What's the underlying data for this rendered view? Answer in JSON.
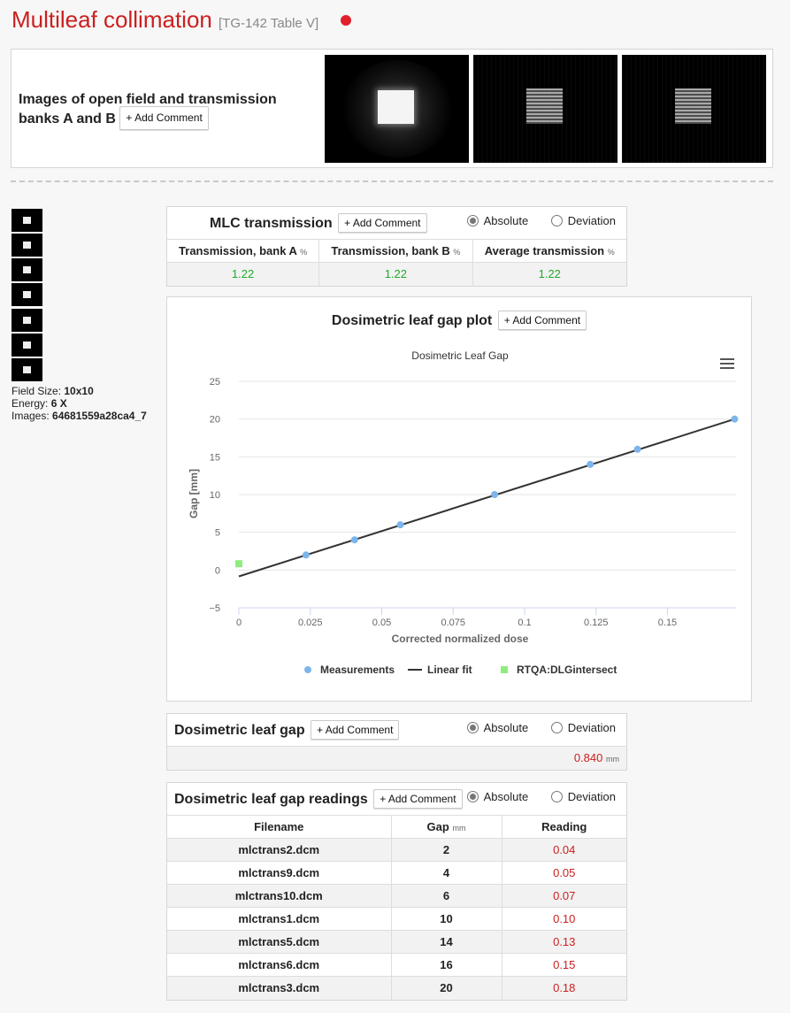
{
  "header": {
    "title": "Multileaf collimation",
    "reference": "[TG-142 Table V]",
    "status_color": "#e0202a"
  },
  "common": {
    "add_comment": "+ Add Comment",
    "absolute": "Absolute",
    "deviation": "Deviation"
  },
  "images_panel": {
    "title": "Images of open field and transmission banks A and B"
  },
  "field_info": {
    "field_size_label": "Field Size:",
    "field_size": "10x10",
    "energy_label": "Energy:",
    "energy": "6 X",
    "images_label": "Images:",
    "images": "64681559a28ca4_7"
  },
  "mlc_transmission": {
    "title": "MLC transmission",
    "mode": "Absolute",
    "columns": [
      {
        "label": "Transmission, bank A",
        "unit": "%"
      },
      {
        "label": "Transmission, bank B",
        "unit": "%"
      },
      {
        "label": "Average transmission",
        "unit": "%"
      }
    ],
    "values": [
      "1.22",
      "1.22",
      "1.22"
    ]
  },
  "chart_panel": {
    "title": "Dosimetric leaf gap plot"
  },
  "chart_data": {
    "type": "scatter",
    "title": "Dosimetric Leaf Gap",
    "xlabel": "Corrected normalized dose",
    "ylabel": "Gap [mm]",
    "xlim": [
      0,
      0.174
    ],
    "ylim": [
      -5,
      25
    ],
    "xticks": [
      "0",
      "0.025",
      "0.05",
      "0.075",
      "0.1",
      "0.125",
      "0.15"
    ],
    "yticks": [
      "25",
      "20",
      "15",
      "10",
      "5",
      "0",
      "−5"
    ],
    "grid": true,
    "legend_position": "bottom",
    "series": [
      {
        "name": "Measurements",
        "type": "scatter",
        "color": "#7cb5ec",
        "x": [
          0.0235,
          0.0405,
          0.0565,
          0.0895,
          0.123,
          0.1395,
          0.1735
        ],
        "y": [
          2,
          4,
          6,
          10,
          14,
          16,
          20
        ]
      },
      {
        "name": "Linear fit",
        "type": "line",
        "color": "#333333",
        "x": [
          0,
          0.1735
        ],
        "y": [
          -0.84,
          20
        ]
      },
      {
        "name": "RTQA:DLGintersect",
        "type": "scatter",
        "marker": "square",
        "color": "#90ed7d",
        "x": [
          0
        ],
        "y": [
          0.84
        ]
      }
    ]
  },
  "dlg": {
    "title": "Dosimetric leaf gap",
    "mode": "Absolute",
    "value": "0.840",
    "unit": "mm"
  },
  "dlg_readings": {
    "title": "Dosimetric leaf gap readings",
    "mode": "Absolute",
    "columns": [
      "Filename",
      "Gap",
      "Reading"
    ],
    "gap_unit": "mm",
    "rows": [
      {
        "filename": "mlctrans2.dcm",
        "gap": "2",
        "reading": "0.04"
      },
      {
        "filename": "mlctrans9.dcm",
        "gap": "4",
        "reading": "0.05"
      },
      {
        "filename": "mlctrans10.dcm",
        "gap": "6",
        "reading": "0.07"
      },
      {
        "filename": "mlctrans1.dcm",
        "gap": "10",
        "reading": "0.10"
      },
      {
        "filename": "mlctrans5.dcm",
        "gap": "14",
        "reading": "0.13"
      },
      {
        "filename": "mlctrans6.dcm",
        "gap": "16",
        "reading": "0.15"
      },
      {
        "filename": "mlctrans3.dcm",
        "gap": "20",
        "reading": "0.18"
      }
    ]
  }
}
